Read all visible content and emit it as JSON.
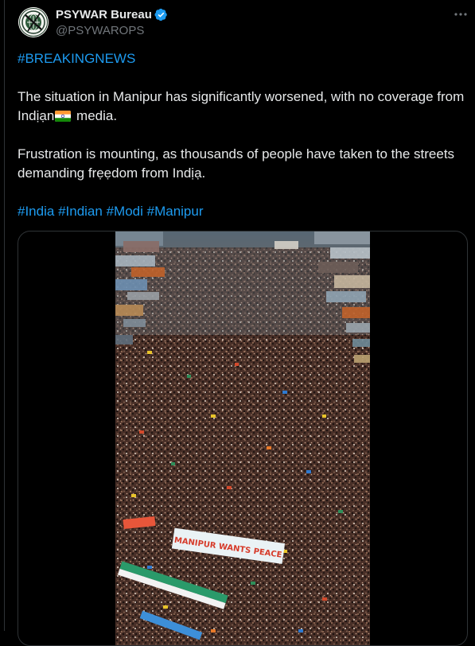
{
  "author": {
    "display_name": "PSYWAR Bureau",
    "handle": "@PSYWAROPS",
    "verified": true,
    "avatar_icon": "psywar-emblem-avatar"
  },
  "tweet": {
    "hashtag_top": "#BREAKINGNEWS",
    "para1_before_flag": "The situation in Manipur has significantly worsened, with no coverage from Indịạn",
    "para1_flag_icon": "india-flag-icon",
    "para1_after_flag": " media.",
    "para2": "Frustration is mounting, as thousands of people have taken to the streets demanding frẹẹdom from Indịạ.",
    "hashtags": [
      "#India",
      "#Indian",
      "#Modi",
      "#Manipur"
    ]
  },
  "media": {
    "banner_text": "MANIPUR WANTS PEACE"
  },
  "colors": {
    "background": "#000000",
    "text": "#e7e9ea",
    "muted": "#71767b",
    "link": "#1d9bf0",
    "border": "#2f3336",
    "verified": "#1d9bf0"
  }
}
